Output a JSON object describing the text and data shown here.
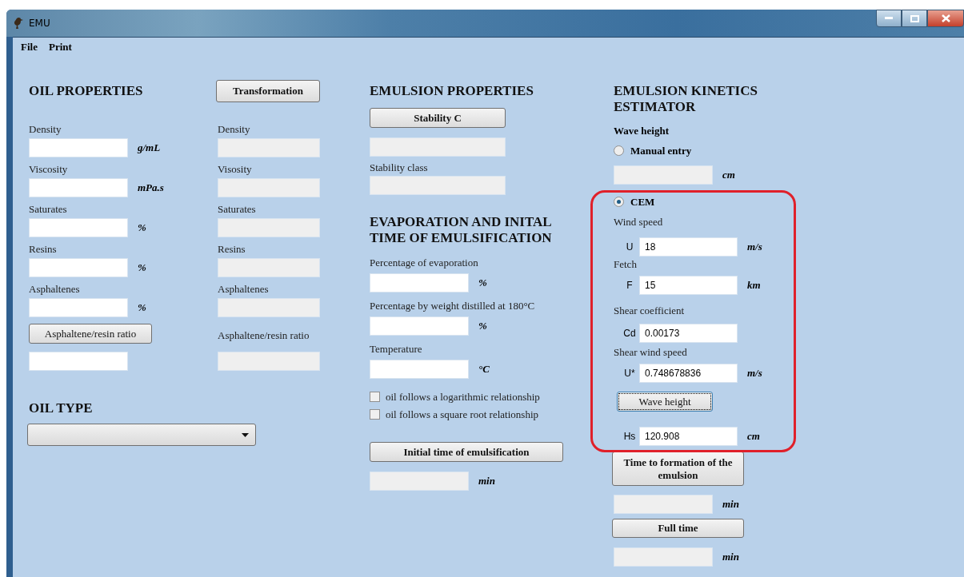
{
  "window": {
    "title": "EMU"
  },
  "menu": [
    {
      "label": "File"
    },
    {
      "label": "Print"
    }
  ],
  "oil_properties": {
    "title": "OIL PROPERTIES",
    "fields": [
      {
        "label": "Density",
        "unit": "g/mL",
        "disabled": false
      },
      {
        "label": "Viscosity",
        "unit": "mPa.s",
        "disabled": false
      },
      {
        "label": "Saturates",
        "unit": "%",
        "disabled": false
      },
      {
        "label": "Resins",
        "unit": "%",
        "disabled": false
      },
      {
        "label": "Asphaltenes",
        "unit": "%",
        "disabled": false
      }
    ],
    "ratio_button": "Asphaltene/resin ratio",
    "ratio_field": {
      "disabled": false
    }
  },
  "transformation": {
    "button": "Transformation",
    "fields": [
      {
        "label": "Density",
        "disabled": true
      },
      {
        "label": "Visosity",
        "disabled": true
      },
      {
        "label": "Saturates",
        "disabled": true
      },
      {
        "label": "Resins",
        "disabled": true
      },
      {
        "label": "Asphaltenes",
        "disabled": true
      }
    ],
    "ratio_label": "Asphaltene/resin ratio",
    "ratio_field": {
      "disabled": true
    }
  },
  "oil_type": {
    "title": "OIL TYPE"
  },
  "emulsion_properties": {
    "title": "EMULSION PROPERTIES",
    "button": "Stability C",
    "stability_field": {
      "disabled": true
    },
    "stability_label": "Stability class",
    "class_field": {
      "disabled": true
    }
  },
  "evaporation": {
    "title": "EVAPORATION AND INITAL TIME OF EMULSIFICATION",
    "fields": [
      {
        "label": "Percentage of evaporation",
        "unit": "%",
        "disabled": false
      },
      {
        "label": "Percentage by weight distilled at 180°C",
        "unit": "%",
        "disabled": false
      },
      {
        "label": "Temperature",
        "unit": "°C",
        "disabled": false
      }
    ],
    "checkboxes": [
      {
        "label": "oil follows a logarithmic relationship",
        "checked": false
      },
      {
        "label": "oil follows a square root relationship",
        "checked": false
      }
    ],
    "button": "Initial time of emulsification",
    "result": {
      "unit": "min",
      "disabled": true
    }
  },
  "kinetics": {
    "title": "EMULSION KINETICS ESTIMATOR",
    "wave_height_label": "Wave height",
    "manual_option": {
      "label": "Manual entry",
      "selected": false
    },
    "manual_field": {
      "unit": "cm",
      "disabled": true
    },
    "cem_option": {
      "label": "CEM",
      "selected": true
    },
    "cem_fields": [
      {
        "label": "Wind speed",
        "symbol": "U",
        "value": "18",
        "unit": "m/s",
        "disabled": false
      },
      {
        "label": "Fetch",
        "symbol": "F",
        "value": "15",
        "unit": "km",
        "disabled": false
      },
      {
        "label": "Shear coefficient",
        "symbol": "Cd",
        "value": "0.00173",
        "disabled": false
      },
      {
        "label": "Shear wind speed",
        "symbol": "U*",
        "value": "0.748678836",
        "unit": "m/s",
        "disabled": false
      }
    ],
    "wave_button": "Wave height",
    "hs_field": {
      "symbol": "Hs",
      "value": "120.908",
      "unit": "cm",
      "disabled": false
    },
    "formation_button": "Time to formation of the emulsion",
    "formation_field": {
      "unit": "min",
      "disabled": true
    },
    "full_button": "Full time",
    "full_field": {
      "unit": "min",
      "disabled": true
    }
  }
}
